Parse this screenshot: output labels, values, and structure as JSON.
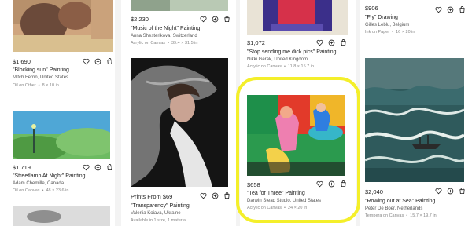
{
  "col1": {
    "item1": {
      "price": "$1,690",
      "title": "\"Blocking sun\" Painting",
      "artist": "Mitch Ferrin, United States",
      "medium": "Oil on Other",
      "size": "8 × 10 in"
    },
    "item2": {
      "price": "$1,719",
      "title": "\"Streetlamp At Night\" Painting",
      "artist": "Adam Chemille, Canada",
      "medium": "Oil on Canvas",
      "size": "48 × 23.6 in"
    }
  },
  "col2": {
    "item1": {
      "price": "$2,230",
      "title": "\"Music of the Night\" Painting",
      "artist": "Anna Shesterikova, Switzerland",
      "medium": "Acrylic on Canvas",
      "size": "39.4 × 31.5 in"
    },
    "item2": {
      "price": "Prints From $69",
      "title": "\"Transparency\" Painting",
      "artist": "Valeriia Koiava, Ukraine",
      "medium": "Available in 1 size, 1 material"
    }
  },
  "col3": {
    "item1": {
      "price": "$1,072",
      "title": "\"Stop sending me dick pics\" Painting",
      "artist": "Nikki Gerak, United Kingdom",
      "medium": "Acrylic on Canvas",
      "size": "11.8 × 15.7 in"
    },
    "item2": {
      "price": "$658",
      "title": "\"Tea for Three\" Painting",
      "artist": "Darwin Stead Studio, United States",
      "medium": "Acrylic on Canvas",
      "size": "24 × 20 in"
    }
  },
  "col4": {
    "item1": {
      "price": "$906",
      "title": "\"Fly\" Drawing",
      "artist": "Gilles Leblu, Belgium",
      "medium": "Ink on Paper",
      "size": "16 × 20 in"
    },
    "item2": {
      "price": "$2,040",
      "title": "\"Rowing out at Sea\" Painting",
      "artist": "Peter De Boer, Netherlands",
      "medium": "Tempera on Canvas",
      "size": "15.7 × 19.7 in"
    }
  },
  "icons": [
    "heart-icon",
    "add-circle-icon",
    "cart-icon"
  ],
  "colors": {
    "highlight": "#f4ef2a",
    "text": "#222222",
    "muted": "#888888"
  }
}
